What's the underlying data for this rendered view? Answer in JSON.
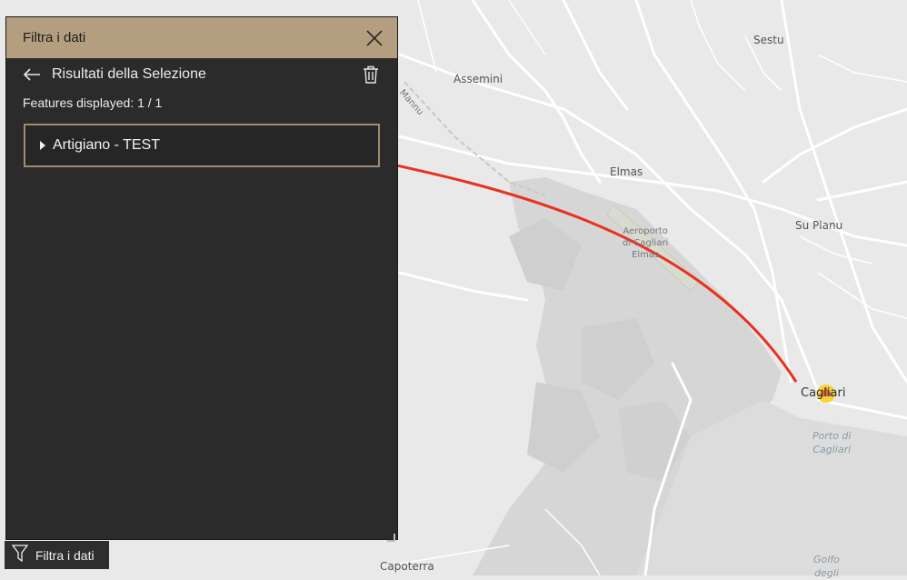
{
  "panel": {
    "title": "Filtra i dati",
    "close_icon": "close-icon",
    "results_title": "Risultati della Selezione",
    "back_icon": "arrow-left-icon",
    "trash_icon": "trash-icon",
    "features_displayed": "Features displayed: 1 / 1",
    "feature_item": "Artigiano - TEST"
  },
  "bottom_button": {
    "label": "Filtra i dati",
    "icon": "filter-icon"
  },
  "map": {
    "labels": {
      "sestu": "Sestu",
      "assemini": "Assemini",
      "mannu": "Mannu",
      "elmas": "Elmas",
      "su_planu": "Su Planu",
      "airport_line1": "Aeroporto",
      "airport_line2": "di Cagliari",
      "airport_line3": "Elmas",
      "cagliari": "Cagliari",
      "porto_line1": "Porto di",
      "porto_line2": "Cagliari",
      "golfo_line1": "Golfo",
      "golfo_line2": "degli",
      "capoterra": "Capoterra"
    },
    "colors": {
      "land": "#e9e9e9",
      "water": "#d6d6d6",
      "roads": "#ffffff",
      "annotation_line": "#e8321e",
      "marker": "#f5d020"
    }
  }
}
